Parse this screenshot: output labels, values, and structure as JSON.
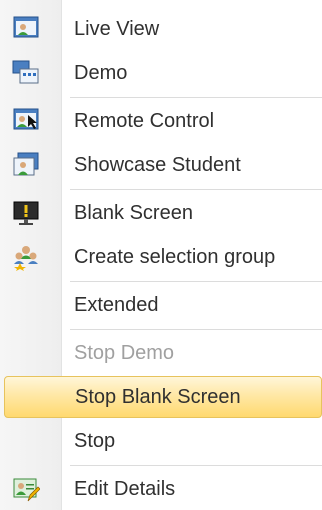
{
  "menu": {
    "items": [
      {
        "label": "Live View",
        "icon": "live-view-icon",
        "disabled": false,
        "selected": false
      },
      {
        "label": "Demo",
        "icon": "demo-icon",
        "disabled": false,
        "selected": false
      },
      {
        "label": "Remote Control",
        "icon": "remote-control-icon",
        "disabled": false,
        "selected": false
      },
      {
        "label": "Showcase Student",
        "icon": "showcase-student-icon",
        "disabled": false,
        "selected": false
      },
      {
        "label": "Blank Screen",
        "icon": "blank-screen-icon",
        "disabled": false,
        "selected": false
      },
      {
        "label": "Create selection group",
        "icon": "group-icon",
        "disabled": false,
        "selected": false
      },
      {
        "label": "Extended",
        "icon": "",
        "disabled": false,
        "selected": false
      },
      {
        "label": "Stop Demo",
        "icon": "",
        "disabled": true,
        "selected": false
      },
      {
        "label": "Stop Blank Screen",
        "icon": "",
        "disabled": false,
        "selected": true
      },
      {
        "label": "Stop",
        "icon": "",
        "disabled": false,
        "selected": false
      },
      {
        "label": "Edit Details",
        "icon": "edit-details-icon",
        "disabled": false,
        "selected": false
      }
    ]
  },
  "colors": {
    "highlight_border": "#e7c35d",
    "highlight_fill": "#ffe8a6",
    "disabled_text": "#a0a0a0",
    "text": "#303030"
  }
}
